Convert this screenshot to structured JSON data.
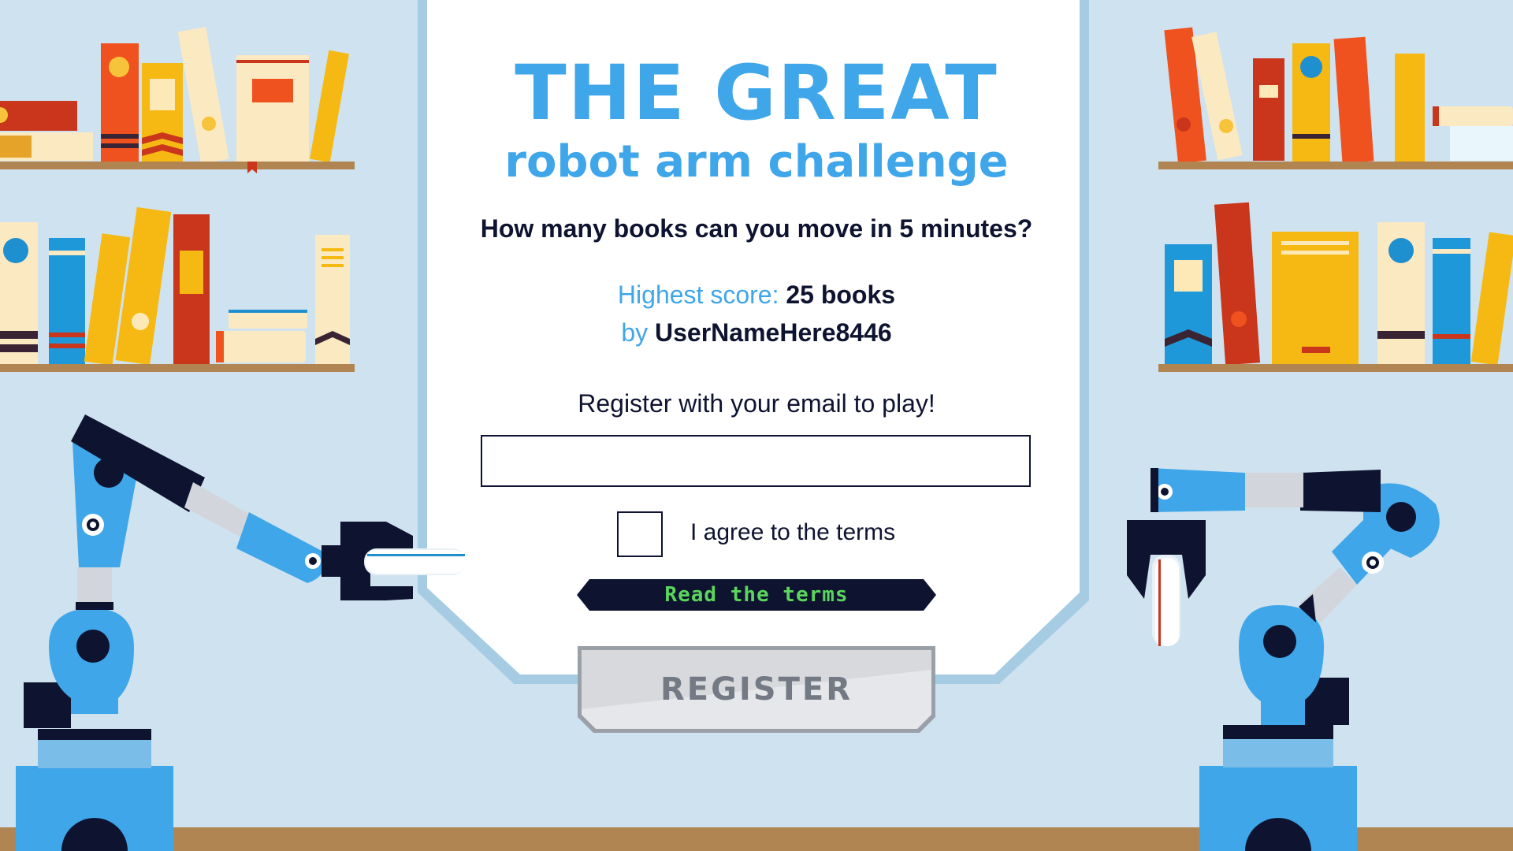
{
  "title": {
    "line1": "THE GREAT",
    "line2": "robot arm challenge"
  },
  "question": "How many books can you move in 5 minutes?",
  "highscore": {
    "label": "Highest score:",
    "value": "25 books",
    "by_label": "by",
    "username": "UserNameHere8446"
  },
  "register": {
    "prompt": "Register with your email to play!",
    "email_value": "",
    "agree_label": "I agree to the terms",
    "agree_checked": false,
    "read_terms_label": "Read the terms",
    "button_label": "REGISTER"
  },
  "colors": {
    "accent_blue": "#3fa6ea",
    "dark_navy": "#0e1430",
    "terms_green": "#5bd65c",
    "background": "#cfe2ef"
  },
  "icons": {
    "robot_left": "robot-arm-icon",
    "robot_right": "robot-arm-icon",
    "bookshelf": "bookshelf-icon"
  }
}
